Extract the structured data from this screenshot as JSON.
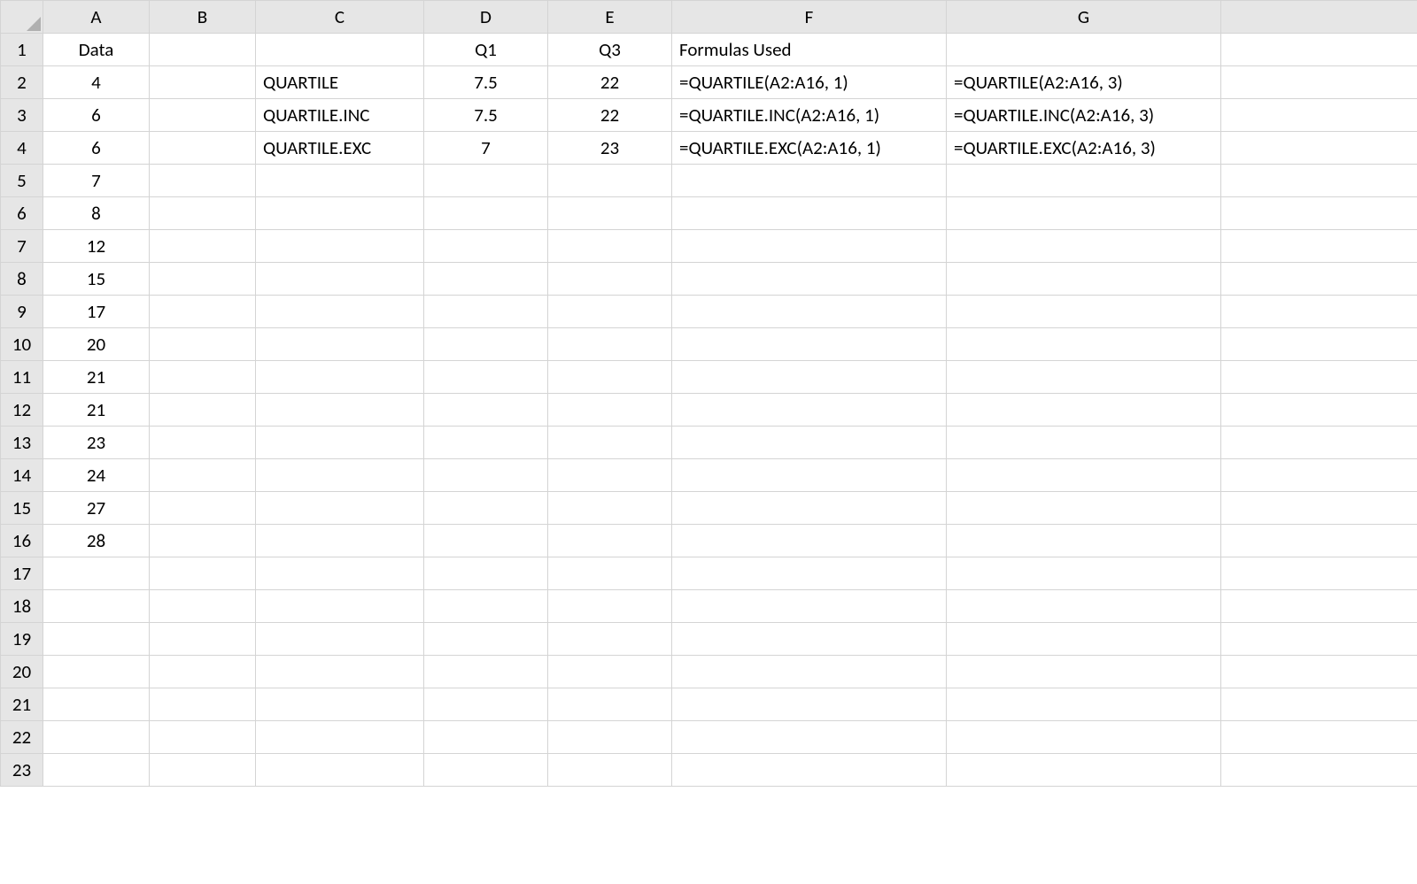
{
  "columns": [
    "A",
    "B",
    "C",
    "D",
    "E",
    "F",
    "G",
    ""
  ],
  "rowCount": 23,
  "cells": {
    "A1": {
      "v": "Data",
      "cls": "center bold"
    },
    "D1": {
      "v": "Q1",
      "cls": "center bold"
    },
    "E1": {
      "v": "Q3",
      "cls": "center bold"
    },
    "F1": {
      "v": "Formulas Used",
      "cls": "left"
    },
    "A2": {
      "v": "4",
      "cls": "center"
    },
    "C2": {
      "v": "QUARTILE",
      "cls": "left bold"
    },
    "D2": {
      "v": "7.5",
      "cls": "center"
    },
    "E2": {
      "v": "22",
      "cls": "center"
    },
    "F2": {
      "v": "=QUARTILE(A2:A16, 1)",
      "cls": "left"
    },
    "G2": {
      "v": "=QUARTILE(A2:A16, 3)",
      "cls": "left"
    },
    "A3": {
      "v": "6",
      "cls": "center"
    },
    "C3": {
      "v": "QUARTILE.INC",
      "cls": "left bold"
    },
    "D3": {
      "v": "7.5",
      "cls": "center"
    },
    "E3": {
      "v": "22",
      "cls": "center"
    },
    "F3": {
      "v": "=QUARTILE.INC(A2:A16, 1)",
      "cls": "left"
    },
    "G3": {
      "v": "=QUARTILE.INC(A2:A16, 3)",
      "cls": "left"
    },
    "A4": {
      "v": "6",
      "cls": "center"
    },
    "C4": {
      "v": "QUARTILE.EXC",
      "cls": "left bold"
    },
    "D4": {
      "v": "7",
      "cls": "center"
    },
    "E4": {
      "v": "23",
      "cls": "center"
    },
    "F4": {
      "v": "=QUARTILE.EXC(A2:A16, 1)",
      "cls": "left"
    },
    "G4": {
      "v": "=QUARTILE.EXC(A2:A16, 3)",
      "cls": "left"
    },
    "A5": {
      "v": "7",
      "cls": "center"
    },
    "A6": {
      "v": "8",
      "cls": "center"
    },
    "A7": {
      "v": "12",
      "cls": "center"
    },
    "A8": {
      "v": "15",
      "cls": "center"
    },
    "A9": {
      "v": "17",
      "cls": "center"
    },
    "A10": {
      "v": "20",
      "cls": "center"
    },
    "A11": {
      "v": "21",
      "cls": "center"
    },
    "A12": {
      "v": "21",
      "cls": "center"
    },
    "A13": {
      "v": "23",
      "cls": "center"
    },
    "A14": {
      "v": "24",
      "cls": "center"
    },
    "A15": {
      "v": "27",
      "cls": "center"
    },
    "A16": {
      "v": "28",
      "cls": "center"
    }
  }
}
